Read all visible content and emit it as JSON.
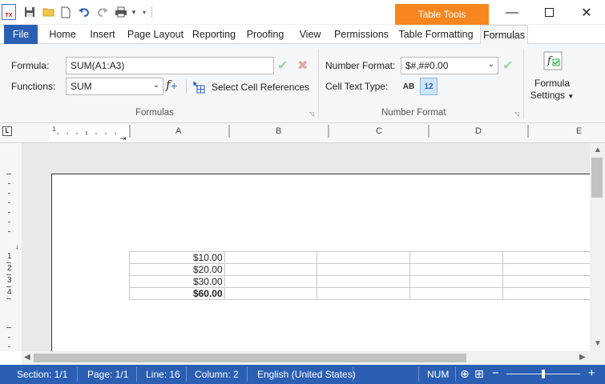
{
  "titlebar": {
    "app_icon_text": "TX",
    "context_tab": "Table Tools",
    "icons": [
      "save-icon",
      "open-folder-icon",
      "new-document-icon",
      "undo-icon",
      "redo-icon",
      "print-icon",
      "dropdown-icon",
      "customize-icon"
    ],
    "window_buttons": [
      "minimize-icon",
      "maximize-icon",
      "close-icon"
    ]
  },
  "tabs": [
    {
      "label": "File"
    },
    {
      "label": "Home"
    },
    {
      "label": "Insert"
    },
    {
      "label": "Page Layout"
    },
    {
      "label": "Reporting"
    },
    {
      "label": "Proofing"
    },
    {
      "label": "View"
    },
    {
      "label": "Permissions"
    },
    {
      "label": "Table Formatting"
    },
    {
      "label": "Formulas"
    }
  ],
  "ribbon": {
    "formula_label": "Formula:",
    "formula_value": "SUM(A1:A3)",
    "functions_label": "Functions:",
    "functions_value": "SUM",
    "select_refs_label": "Select Cell References",
    "formulas_group": "Formulas",
    "number_format_label": "Number Format:",
    "number_format_value": "$#,##0.00",
    "cell_text_type_label": "Cell Text Type:",
    "text_type_ab": "AB",
    "text_type_12": "12",
    "number_format_group": "Number Format",
    "formula_settings_line1": "Formula",
    "formula_settings_line2": "Settings"
  },
  "ruler": {
    "corner": "L",
    "columns": [
      "A",
      "B",
      "C",
      "D",
      "E"
    ],
    "start_mark": "1",
    "row_numbers": [
      "1",
      "2",
      "3",
      "4"
    ]
  },
  "table": {
    "rows": [
      [
        "$10.00",
        "",
        "",
        "",
        ""
      ],
      [
        "$20.00",
        "",
        "",
        "",
        ""
      ],
      [
        "$30.00",
        "",
        "",
        "",
        ""
      ],
      [
        "$60.00",
        "",
        "",
        "",
        ""
      ]
    ]
  },
  "status": {
    "section": "Section: 1/1",
    "page": "Page: 1/1",
    "line": "Line: 16",
    "column": "Column: 2",
    "language": "English (United States)",
    "num": "NUM",
    "zoom_out": "−",
    "zoom_in": "+"
  },
  "colors": {
    "accent": "#2b5fb3",
    "context_tab": "#f7861e",
    "check_green": "#2eb24a",
    "cancel_red": "#d9534f"
  }
}
